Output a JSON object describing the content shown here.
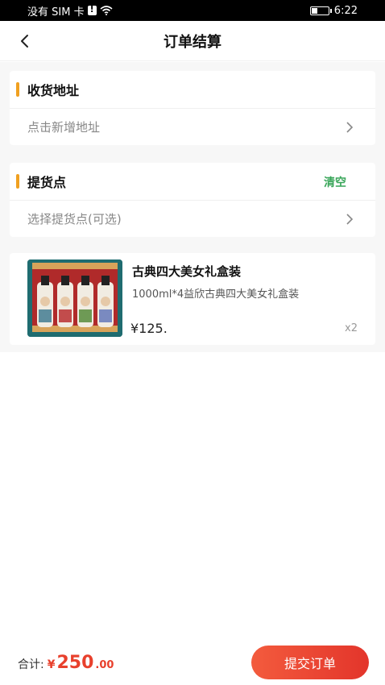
{
  "status_bar": {
    "carrier": "没有 SIM 卡",
    "time": "6:22",
    "battery_level": 0.35
  },
  "nav": {
    "title": "订单结算"
  },
  "address": {
    "title": "收货地址",
    "placeholder": "点击新增地址"
  },
  "pickup": {
    "title": "提货点",
    "clear_label": "清空",
    "placeholder": "选择提货点(可选)"
  },
  "product": {
    "name": "古典四大美女礼盒装",
    "desc": "1000ml*4益欣古典四大美女礼盒装",
    "price": "¥125.",
    "qty": "x2"
  },
  "footer": {
    "total_label": "合计:",
    "currency": "¥",
    "total_int": "250",
    "total_dec": ".00",
    "submit_label": "提交订单"
  },
  "colors": {
    "accent": "#f0a020",
    "price_red": "#e8402c",
    "clear_green": "#3aa65a"
  }
}
